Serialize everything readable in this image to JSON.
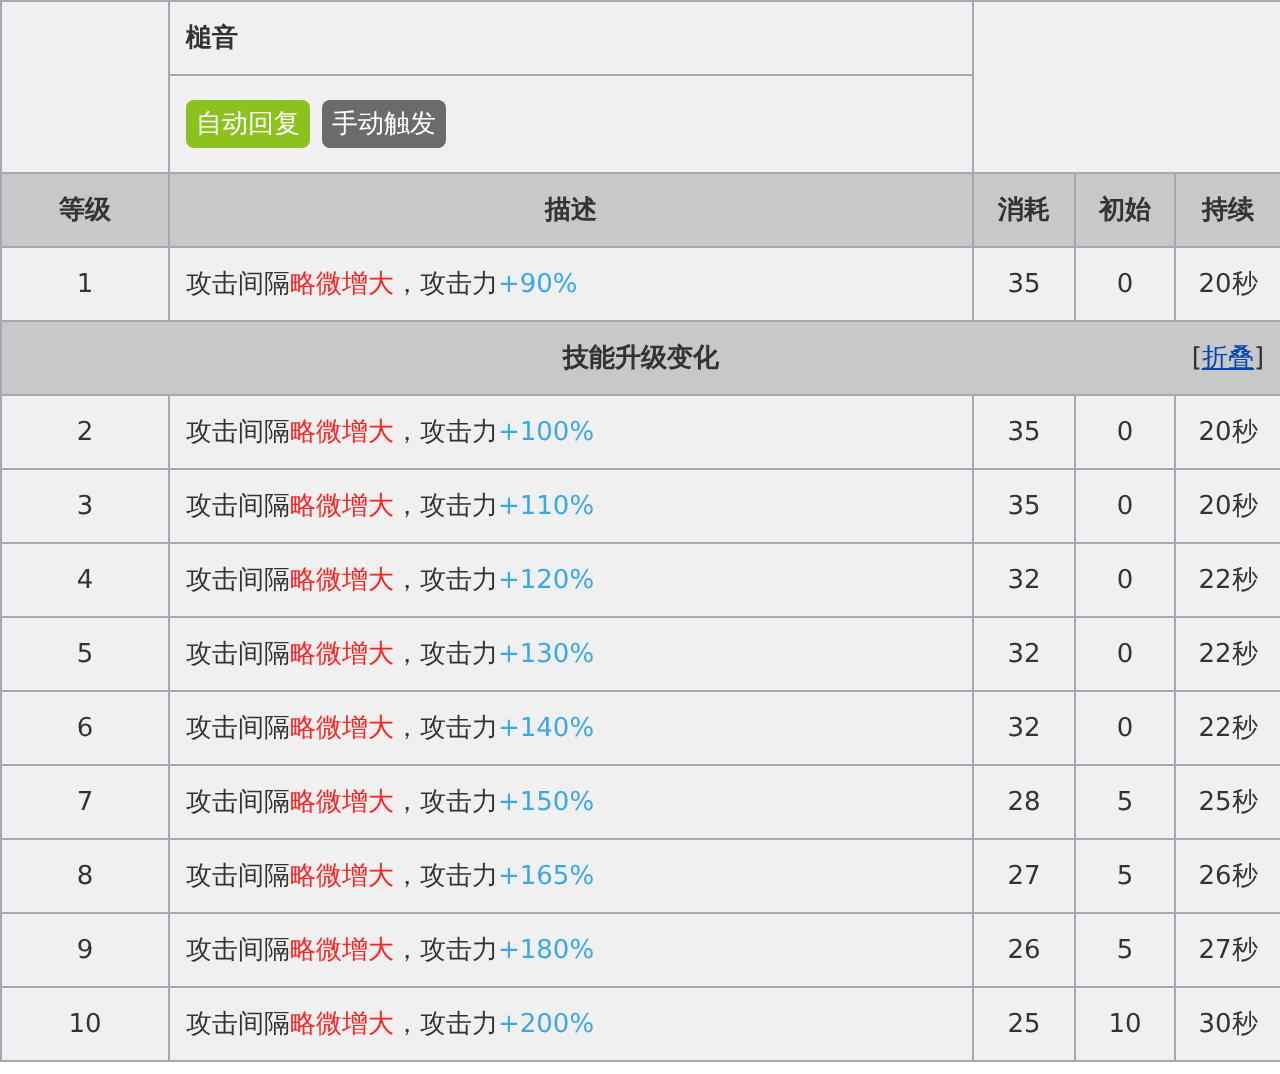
{
  "skill": {
    "name": "槌音",
    "tags": [
      {
        "label": "自动回复",
        "color": "#8cc21f"
      },
      {
        "label": "手动触发",
        "color": "#6b6b6b"
      }
    ]
  },
  "table": {
    "columns": [
      "等级",
      "描述",
      "消耗",
      "初始",
      "持续"
    ],
    "base_rows": [
      {
        "level": "1",
        "description": [
          {
            "kind": "plain",
            "text": "攻击间隔"
          },
          {
            "kind": "debuff",
            "text": "略微增大"
          },
          {
            "kind": "plain",
            "text": "，攻击力"
          },
          {
            "kind": "buff",
            "text": "+90%"
          }
        ],
        "cost": "35",
        "initial": "0",
        "duration": "20秒"
      }
    ],
    "section": {
      "title": "技能升级变化",
      "toggle": {
        "before": "[",
        "label": "折叠",
        "after": "]"
      }
    },
    "upgrade_rows": [
      {
        "level": "2",
        "description": [
          {
            "kind": "plain",
            "text": "攻击间隔"
          },
          {
            "kind": "debuff",
            "text": "略微增大"
          },
          {
            "kind": "plain",
            "text": "，攻击力"
          },
          {
            "kind": "buff",
            "text": "+100%"
          }
        ],
        "cost": "35",
        "initial": "0",
        "duration": "20秒"
      },
      {
        "level": "3",
        "description": [
          {
            "kind": "plain",
            "text": "攻击间隔"
          },
          {
            "kind": "debuff",
            "text": "略微增大"
          },
          {
            "kind": "plain",
            "text": "，攻击力"
          },
          {
            "kind": "buff",
            "text": "+110%"
          }
        ],
        "cost": "35",
        "initial": "0",
        "duration": "20秒"
      },
      {
        "level": "4",
        "description": [
          {
            "kind": "plain",
            "text": "攻击间隔"
          },
          {
            "kind": "debuff",
            "text": "略微增大"
          },
          {
            "kind": "plain",
            "text": "，攻击力"
          },
          {
            "kind": "buff",
            "text": "+120%"
          }
        ],
        "cost": "32",
        "initial": "0",
        "duration": "22秒"
      },
      {
        "level": "5",
        "description": [
          {
            "kind": "plain",
            "text": "攻击间隔"
          },
          {
            "kind": "debuff",
            "text": "略微增大"
          },
          {
            "kind": "plain",
            "text": "，攻击力"
          },
          {
            "kind": "buff",
            "text": "+130%"
          }
        ],
        "cost": "32",
        "initial": "0",
        "duration": "22秒"
      },
      {
        "level": "6",
        "description": [
          {
            "kind": "plain",
            "text": "攻击间隔"
          },
          {
            "kind": "debuff",
            "text": "略微增大"
          },
          {
            "kind": "plain",
            "text": "，攻击力"
          },
          {
            "kind": "buff",
            "text": "+140%"
          }
        ],
        "cost": "32",
        "initial": "0",
        "duration": "22秒"
      },
      {
        "level": "7",
        "description": [
          {
            "kind": "plain",
            "text": "攻击间隔"
          },
          {
            "kind": "debuff",
            "text": "略微增大"
          },
          {
            "kind": "plain",
            "text": "，攻击力"
          },
          {
            "kind": "buff",
            "text": "+150%"
          }
        ],
        "cost": "28",
        "initial": "5",
        "duration": "25秒"
      },
      {
        "level": "8",
        "description": [
          {
            "kind": "plain",
            "text": "攻击间隔"
          },
          {
            "kind": "debuff",
            "text": "略微增大"
          },
          {
            "kind": "plain",
            "text": "，攻击力"
          },
          {
            "kind": "buff",
            "text": "+165%"
          }
        ],
        "cost": "27",
        "initial": "5",
        "duration": "26秒"
      },
      {
        "level": "9",
        "description": [
          {
            "kind": "plain",
            "text": "攻击间隔"
          },
          {
            "kind": "debuff",
            "text": "略微增大"
          },
          {
            "kind": "plain",
            "text": "，攻击力"
          },
          {
            "kind": "buff",
            "text": "+180%"
          }
        ],
        "cost": "26",
        "initial": "5",
        "duration": "27秒"
      },
      {
        "level": "10",
        "description": [
          {
            "kind": "plain",
            "text": "攻击间隔"
          },
          {
            "kind": "debuff",
            "text": "略微增大"
          },
          {
            "kind": "plain",
            "text": "，攻击力"
          },
          {
            "kind": "buff",
            "text": "+200%"
          }
        ],
        "cost": "25",
        "initial": "10",
        "duration": "30秒"
      }
    ]
  }
}
